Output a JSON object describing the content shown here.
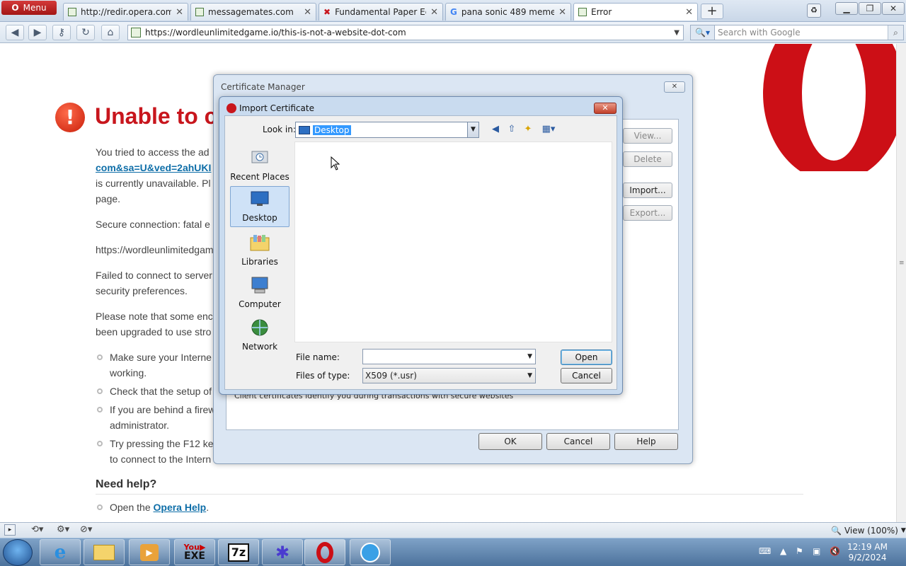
{
  "browser": {
    "menu_label": "Menu",
    "tabs": [
      {
        "title": "http://redir.opera.com..."
      },
      {
        "title": "messagemates.com"
      },
      {
        "title": "Fundamental Paper Ed..."
      },
      {
        "title": "pana sonic 489 meme ..."
      },
      {
        "title": "Error"
      }
    ],
    "url": "https://wordleunlimitedgame.io/this-is-not-a-website-dot-com",
    "search_placeholder": "Search with Google",
    "zoom_label": "View (100%)"
  },
  "page": {
    "error_title": "Unable to c",
    "lines": [
      "You tried to access the ad",
      "com&sa=U&ved=2ahUKI",
      "is currently unavailable. Pl",
      "page.",
      "Secure connection: fatal e",
      "https://wordleunlimitedgam",
      "Failed to connect to server",
      "security preferences.",
      "Please note that some enc",
      "been upgraded to use stro"
    ],
    "bullets": [
      {
        "l1": "Make sure your Interne",
        "l2": "working."
      },
      {
        "l1": "Check that the setup of",
        "l2": ""
      },
      {
        "l1": "If you are behind a firew",
        "l2": "administrator."
      },
      {
        "l1": "Try pressing the F12 ke",
        "l2": "to connect to the Intern"
      }
    ],
    "need_help": "Need help?",
    "help_prefix": "Open the ",
    "help_link": "Opera Help",
    "help_suffix": "."
  },
  "cert_manager": {
    "title": "Certificate Manager",
    "buttons": {
      "view": "View...",
      "delete": "Delete",
      "import": "Import...",
      "export": "Export..."
    },
    "info_text": "Client certificates identify you during transactions with secure websites",
    "ok": "OK",
    "cancel": "Cancel",
    "help": "Help"
  },
  "import_dialog": {
    "title": "Import Certificate",
    "look_in_label": "Look in:",
    "look_in_value": "Desktop",
    "places": [
      "Recent Places",
      "Desktop",
      "Libraries",
      "Computer",
      "Network"
    ],
    "file_name_label": "File name:",
    "file_name_value": "",
    "files_of_type_label": "Files of type:",
    "files_of_type_value": "X509 (*.usr)",
    "open": "Open",
    "cancel": "Cancel"
  },
  "taskbar": {
    "clock_time": "12:19 AM",
    "clock_date": "9/2/2024",
    "exe_label": "EXE",
    "sevenzip_label": "7z"
  }
}
